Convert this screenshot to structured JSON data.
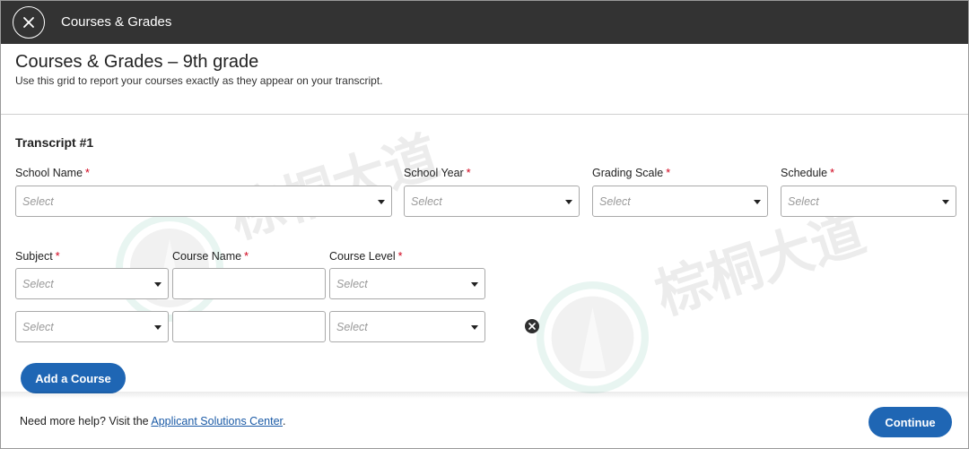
{
  "header": {
    "close_icon": "close-icon",
    "title": "Courses & Grades"
  },
  "page": {
    "title": "Courses & Grades – 9th grade",
    "subtitle": "Use this grid to report your courses exactly as they appear on your transcript."
  },
  "transcript": {
    "title": "Transcript #1",
    "required_marker": "*",
    "fields": {
      "school_name": {
        "label": "School Name",
        "placeholder": "Select"
      },
      "school_year": {
        "label": "School Year",
        "placeholder": "Select"
      },
      "grading_scale": {
        "label": "Grading Scale",
        "placeholder": "Select"
      },
      "schedule": {
        "label": "Schedule",
        "placeholder": "Select"
      }
    },
    "course_columns": {
      "subject": "Subject",
      "course_name": "Course Name",
      "course_level": "Course Level"
    },
    "course_rows": [
      {
        "subject": "Select",
        "course_name": "",
        "course_level": "Select"
      },
      {
        "subject": "Select",
        "course_name": "",
        "course_level": "Select"
      }
    ],
    "add_course_label": "Add a Course"
  },
  "footer": {
    "help_prefix": "Need more help? Visit the ",
    "help_link": "Applicant Solutions Center",
    "help_suffix": ".",
    "continue_label": "Continue"
  },
  "watermark": {
    "text": "棕桐大道"
  },
  "colors": {
    "topbar": "#333333",
    "primary": "#1f66b4",
    "required": "#d0021b",
    "link": "#1a5aa6"
  }
}
